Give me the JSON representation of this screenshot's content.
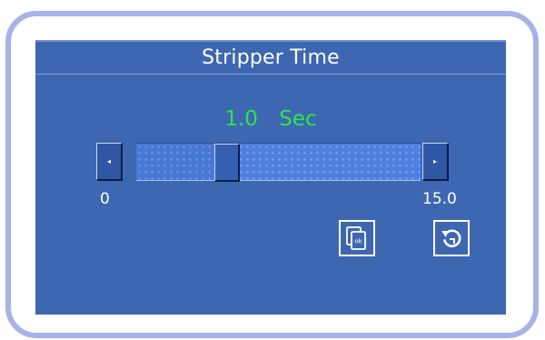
{
  "dialog": {
    "title": "Stripper Time"
  },
  "setting": {
    "value": "1.0",
    "unit": "Sec",
    "min_label": "0",
    "max_label": "15.0",
    "min": 0,
    "max": 15.0,
    "current": 1.0
  },
  "controls": {
    "decrement_icon": "arrow-left-icon",
    "increment_icon": "arrow-right-icon",
    "ok_icon": "copy-ok-icon",
    "undo_icon": "undo-icon"
  },
  "colors": {
    "panel": "#3e67b1",
    "bezel": "#a7b2e8",
    "value_text": "#2ee34a",
    "track": "#4f7ee0"
  }
}
